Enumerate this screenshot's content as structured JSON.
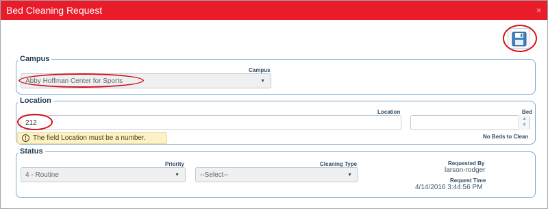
{
  "dialog": {
    "title": "Bed Cleaning Request",
    "close_icon_glyph": "×",
    "save_icon": "floppy-disk-icon"
  },
  "campus": {
    "legend": "Campus",
    "field_label": "Campus",
    "selected": "Abby Hoffman Center for Sports"
  },
  "location": {
    "legend": "Location",
    "field_label": "Location",
    "value": "212",
    "bed_label": "Bed",
    "bed_value": "",
    "no_beds_text": "No Beds to Clean",
    "validation_message": "The field Location must be a number.",
    "warning_icon_glyph": "!"
  },
  "status": {
    "legend": "Status",
    "priority_label": "Priority",
    "priority_value": "4 - Routine",
    "cleaning_type_label": "Cleaning Type",
    "cleaning_type_value": "--Select--",
    "requested_by_label": "Requested By",
    "requested_by_value": "larson-rodger",
    "request_time_label": "Request Time",
    "request_time_value": "4/14/2016 3:44:56 PM"
  },
  "colors": {
    "title_bar": "#ea1c2a",
    "highlight_ring": "#d6101a",
    "group_border": "#79a7cf",
    "warning_background": "#fdf1c8"
  }
}
